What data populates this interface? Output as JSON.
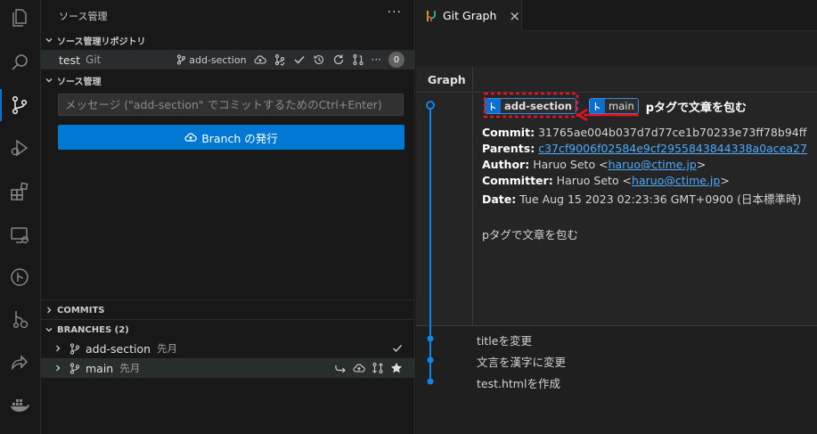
{
  "sidebar": {
    "title": "ソース管理",
    "more": "···",
    "repos_section": "ソース管理リポジトリ",
    "repo": {
      "name": "test",
      "type": "Git",
      "branch": "add-section",
      "badge": "0"
    },
    "scm_section": "ソース管理",
    "message_placeholder": "メッセージ (\"add-section\" でコミットするためのCtrl+Enter)",
    "publish_label": "Branch の発行",
    "commits_section": "COMMITS",
    "branches_section": "BRANCHES (2)",
    "branches": [
      {
        "name": "add-section",
        "time": "先月"
      },
      {
        "name": "main",
        "time": "先月"
      }
    ]
  },
  "editor": {
    "tab_label": "Git Graph",
    "tab_close": "×",
    "graph_header": "Graph",
    "head_commit": {
      "refs": [
        "add-section",
        "main"
      ],
      "message": "pタグで文章を包む",
      "commit_label": "Commit:",
      "commit": "31765ae004b037d7d77ce1b70233e73ff78b94ff",
      "parents_label": "Parents:",
      "parents": "c37cf9006f02584e9cf2955843844338a0acea27",
      "author_label": "Author:",
      "author_name": "Haruo Seto <",
      "author_email": "haruo@ctime.jp",
      "author_close": ">",
      "committer_label": "Committer:",
      "committer_name": "Haruo Seto <",
      "committer_email": "haruo@ctime.jp",
      "committer_close": ">",
      "date_label": "Date:",
      "date": "Tue Aug 15 2023 02:23:36 GMT+0900 (日本標準時)",
      "body": "pタグで文章を包む"
    },
    "commits": [
      {
        "message": "titleを変更"
      },
      {
        "message": "文言を漢字に変更"
      },
      {
        "message": "test.htmlを作成"
      }
    ]
  },
  "colors": {
    "accent": "#0078d4",
    "graph_line": "#0f85e8",
    "highlight_red": "#e81123"
  }
}
